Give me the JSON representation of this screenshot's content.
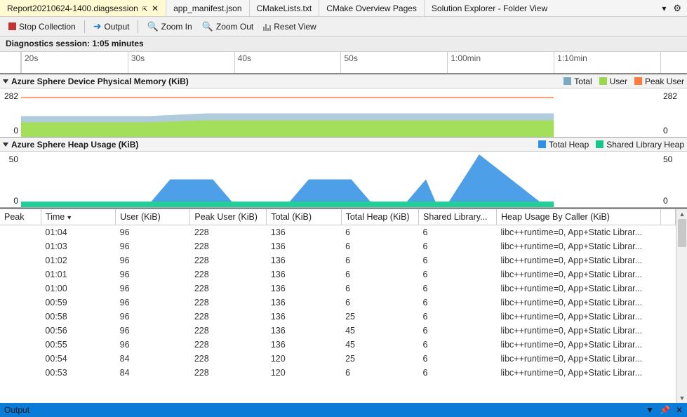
{
  "tabs": {
    "active": "Report20210624-1400.diagsession",
    "items": [
      "app_manifest.json",
      "CMakeLists.txt",
      "CMake Overview Pages",
      "Solution Explorer - Folder View"
    ]
  },
  "toolbar": {
    "stop": "Stop Collection",
    "output": "Output",
    "zoom_in": "Zoom In",
    "zoom_out": "Zoom Out",
    "reset": "Reset View"
  },
  "session": "Diagnostics session: 1:05 minutes",
  "timeline": [
    "20s",
    "30s",
    "40s",
    "50s",
    "1:00min",
    "1:10min"
  ],
  "chart1": {
    "title": "Azure Sphere Device Physical Memory (KiB)",
    "max": "282",
    "min": "0",
    "legend": [
      {
        "c": "#7aa9c4",
        "t": "Total"
      },
      {
        "c": "#97d94a",
        "t": "User"
      },
      {
        "c": "#ff7a3c",
        "t": "Peak User"
      }
    ]
  },
  "chart2": {
    "title": "Azure Sphere Heap Usage (KiB)",
    "max": "50",
    "min": "0",
    "legend": [
      {
        "c": "#2f8fe6",
        "t": "Total Heap"
      },
      {
        "c": "#16c78c",
        "t": "Shared Library Heap"
      }
    ]
  },
  "chart_data": [
    {
      "type": "area",
      "title": "Azure Sphere Device Physical Memory (KiB)",
      "ylim": [
        0,
        282
      ],
      "xrange_s": [
        15,
        75
      ],
      "series": [
        {
          "name": "Peak User",
          "color": "#ff7a3c",
          "kind": "line",
          "values": [
            228,
            228,
            228,
            228,
            228,
            228,
            228
          ]
        },
        {
          "name": "Total",
          "color": "#7aa9c4",
          "kind": "area",
          "values": [
            120,
            120,
            136,
            136,
            136,
            136,
            136
          ]
        },
        {
          "name": "User",
          "color": "#97d94a",
          "kind": "area",
          "values": [
            84,
            84,
            96,
            96,
            96,
            96,
            96
          ]
        }
      ],
      "x": [
        15,
        25,
        30,
        40,
        50,
        60,
        65
      ]
    },
    {
      "type": "area",
      "title": "Azure Sphere Heap Usage (KiB)",
      "ylim": [
        0,
        50
      ],
      "xrange_s": [
        15,
        75
      ],
      "series": [
        {
          "name": "Total Heap",
          "color": "#2f8fe6",
          "kind": "area",
          "x": [
            15,
            27,
            29,
            33,
            35,
            40,
            42,
            46,
            48,
            51,
            53,
            54,
            55,
            57,
            63,
            65
          ],
          "values": [
            0,
            0,
            25,
            25,
            0,
            0,
            25,
            25,
            0,
            0,
            25,
            0,
            0,
            50,
            0,
            0
          ]
        },
        {
          "name": "Shared Library Heap",
          "color": "#16c78c",
          "kind": "area",
          "x": [
            15,
            65
          ],
          "values": [
            6,
            6
          ]
        }
      ]
    }
  ],
  "columns": [
    "Peak",
    "Time",
    "User (KiB)",
    "Peak User (KiB)",
    "Total (KiB)",
    "Total Heap (KiB)",
    "Shared Library...",
    "Heap Usage By Caller (KiB)"
  ],
  "rows": [
    {
      "time": "01:04",
      "user": "96",
      "peak": "228",
      "total": "136",
      "heap": "6",
      "shared": "6",
      "caller": "libc++runtime=0, App+Static Librar..."
    },
    {
      "time": "01:03",
      "user": "96",
      "peak": "228",
      "total": "136",
      "heap": "6",
      "shared": "6",
      "caller": "libc++runtime=0, App+Static Librar..."
    },
    {
      "time": "01:02",
      "user": "96",
      "peak": "228",
      "total": "136",
      "heap": "6",
      "shared": "6",
      "caller": "libc++runtime=0, App+Static Librar..."
    },
    {
      "time": "01:01",
      "user": "96",
      "peak": "228",
      "total": "136",
      "heap": "6",
      "shared": "6",
      "caller": "libc++runtime=0, App+Static Librar..."
    },
    {
      "time": "01:00",
      "user": "96",
      "peak": "228",
      "total": "136",
      "heap": "6",
      "shared": "6",
      "caller": "libc++runtime=0, App+Static Librar..."
    },
    {
      "time": "00:59",
      "user": "96",
      "peak": "228",
      "total": "136",
      "heap": "6",
      "shared": "6",
      "caller": "libc++runtime=0, App+Static Librar..."
    },
    {
      "time": "00:58",
      "user": "96",
      "peak": "228",
      "total": "136",
      "heap": "25",
      "shared": "6",
      "caller": "libc++runtime=0, App+Static Librar..."
    },
    {
      "time": "00:56",
      "user": "96",
      "peak": "228",
      "total": "136",
      "heap": "45",
      "shared": "6",
      "caller": "libc++runtime=0, App+Static Librar..."
    },
    {
      "time": "00:55",
      "user": "96",
      "peak": "228",
      "total": "136",
      "heap": "45",
      "shared": "6",
      "caller": "libc++runtime=0, App+Static Librar..."
    },
    {
      "time": "00:54",
      "user": "84",
      "peak": "228",
      "total": "120",
      "heap": "25",
      "shared": "6",
      "caller": "libc++runtime=0, App+Static Librar..."
    },
    {
      "time": "00:53",
      "user": "84",
      "peak": "228",
      "total": "120",
      "heap": "6",
      "shared": "6",
      "caller": "libc++runtime=0, App+Static Librar..."
    }
  ],
  "output": "Output"
}
